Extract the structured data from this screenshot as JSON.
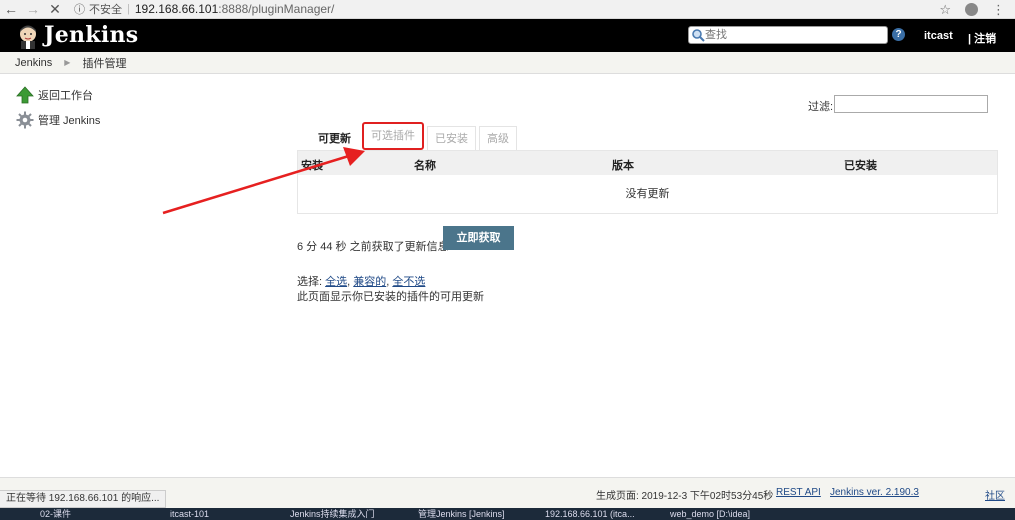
{
  "browser": {
    "back": "←",
    "forward": "→",
    "stop": "✕",
    "info": "ⓘ",
    "security": "不安全",
    "url_host": "192.168.66.101",
    "url_rest": ":8888/pluginManager/",
    "star": "☆"
  },
  "header": {
    "title": "Jenkins",
    "search_placeholder": "查找",
    "help": "?",
    "user": "itcast",
    "logout": "| 注销"
  },
  "breadcrumb": {
    "items": [
      "Jenkins",
      "插件管理"
    ]
  },
  "sidebar": {
    "items": [
      {
        "label": "返回工作台",
        "icon": "up-arrow-icon"
      },
      {
        "label": "管理 Jenkins",
        "icon": "gear-icon"
      }
    ]
  },
  "filter": {
    "label": "过滤:"
  },
  "tabs": [
    {
      "label": "可更新",
      "active": true
    },
    {
      "label": "可选插件",
      "highlighted": true
    },
    {
      "label": "已安装"
    },
    {
      "label": "高级"
    }
  ],
  "table": {
    "headers": [
      "安装",
      "名称",
      "版本",
      "已安装"
    ],
    "empty_message": "没有更新"
  },
  "update_info": {
    "text": "6 分 44 秒 之前获取了更新信息",
    "button": "立即获取"
  },
  "select": {
    "prefix": "选择: ",
    "all": "全选",
    "compatible": "兼容的",
    "none": "全不选",
    "sep1": ", ",
    "sep2": ", "
  },
  "note": "此页面显示你已安装的插件的可用更新",
  "footer": {
    "generated": "生成页面: 2019-12-3 下午02时53分45秒",
    "rest_api": "REST API",
    "version": "Jenkins ver. 2.190.3",
    "community": "社区"
  },
  "status_bar": "正在等待 192.168.66.101 的响应...",
  "taskbar": {
    "items": [
      "02-课件",
      "itcast-101",
      "Jenkins持续集成入门",
      "管理Jenkins [Jenkins]",
      "192.168.66.101 (itca...",
      "web_demo [D:\\idea]"
    ]
  },
  "colors": {
    "header_bg": "#000000",
    "button_bg": "#4b758b",
    "highlight": "#e02020",
    "link": "#204a87"
  }
}
